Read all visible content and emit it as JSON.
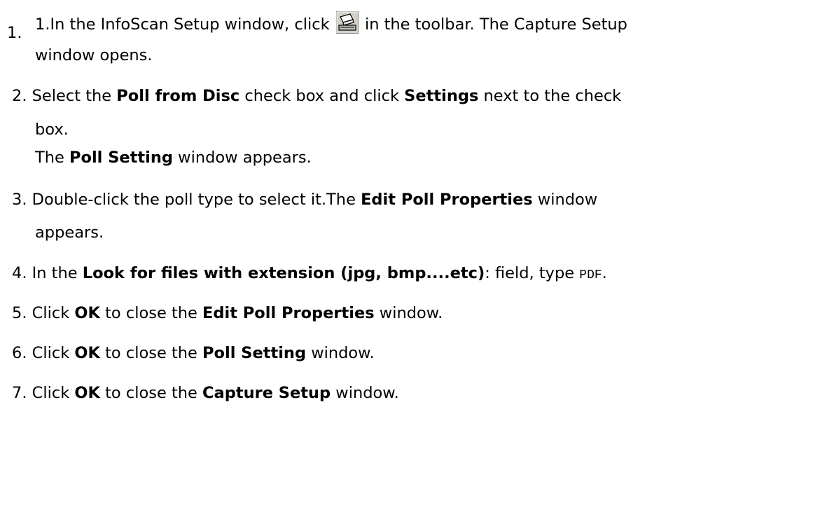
{
  "steps": [
    {
      "number": "1.",
      "prefix": "1.In the InfoScan Setup window, click",
      "icon": "scanner-icon",
      "suffix": "in the toolbar. The Capture Setup",
      "line2": "window opens."
    },
    {
      "number": "2.",
      "a": "Select the ",
      "b": "Poll from Disc",
      "c": " check box and click ",
      "d": "Settings",
      "e": " next to the check",
      "line2": "box.",
      "line3a": "The ",
      "line3b": "Poll Setting",
      "line3c": " window appears."
    },
    {
      "number": "3.",
      "a": "Double-click the poll type to select it.The ",
      "b": "Edit Poll Properties",
      "c": " window",
      "line2": "appears."
    },
    {
      "number": "4.",
      "a": "In the ",
      "b": "Look for files with extension (jpg, bmp....etc)",
      "c": ": field, type ",
      "d": "PDF",
      "e": "."
    },
    {
      "number": "5.",
      "a": "Click ",
      "b": "OK",
      "c": " to close the ",
      "d": "Edit Poll Properties",
      "e": " window."
    },
    {
      "number": "6.",
      "a": "Click ",
      "b": "OK",
      "c": " to close the ",
      "d": "Poll Setting",
      "e": " window."
    },
    {
      "number": "7.",
      "a": "Click ",
      "b": "OK",
      "c": " to close the ",
      "d": "Capture Setup",
      "e": " window."
    }
  ]
}
